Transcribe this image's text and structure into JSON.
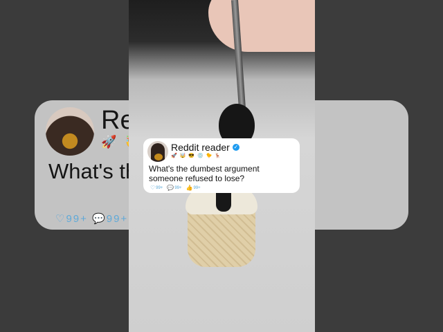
{
  "post": {
    "author": "Reddit reader",
    "verified_icon": "verified-check-icon",
    "emojis": "🚀 🤯 😎 💿 🐤 🦌",
    "question": "What's the dumbest argument someone refused to lose?",
    "reactions": [
      {
        "icon": "heart-icon",
        "glyph": "♡",
        "count": "99+"
      },
      {
        "icon": "comment-icon",
        "glyph": "💬",
        "count": "99+"
      },
      {
        "icon": "thumbs-up-icon",
        "glyph": "👍",
        "count": "99+"
      }
    ]
  },
  "background_blur": {
    "author": "Redd",
    "emojis": "🚀 🤯",
    "question": "What's th                        t someone",
    "reactions": "♡99+   💬99+"
  },
  "colors": {
    "card": "#ffffff",
    "verified": "#1d9bf0",
    "reaction": "#5aa8d6"
  }
}
